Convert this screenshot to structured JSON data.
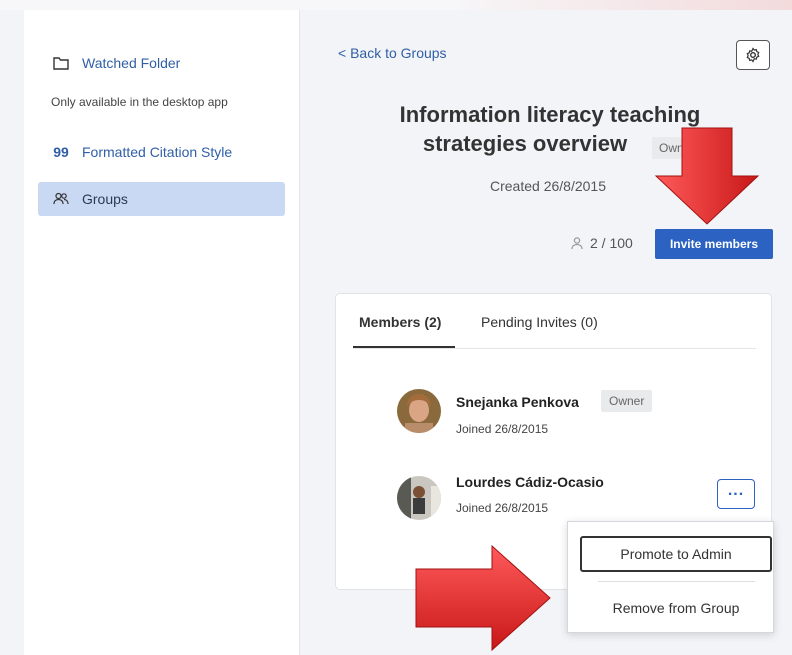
{
  "sidebar": {
    "watched_folder": "Watched Folder",
    "watched_note": "Only available in the desktop app",
    "citation_style": "Formatted Citation Style",
    "groups": "Groups"
  },
  "group": {
    "back_label": "< Back to Groups",
    "title_line1": "Information literacy teaching",
    "title_line2": "strategies overview",
    "owner_badge": "Own",
    "created": "Created 26/8/2015",
    "member_count": "2 / 100",
    "invite_label": "Invite members"
  },
  "tabs": [
    {
      "label": "Members (2)"
    },
    {
      "label": "Pending Invites (0)"
    }
  ],
  "members": [
    {
      "name": "Snejanka Penkova",
      "badge": "Owner",
      "joined": "Joined 26/8/2015"
    },
    {
      "name": "Lourdes Cádiz-Ocasio",
      "joined": "Joined 26/8/2015"
    }
  ],
  "more_label": "...",
  "menu": {
    "promote": "Promote to Admin",
    "remove": "Remove from Group"
  },
  "colors": {
    "accent": "#2c62c1",
    "sidebar_active": "#c9d9f4",
    "arrow_red": "#e02a2a"
  }
}
